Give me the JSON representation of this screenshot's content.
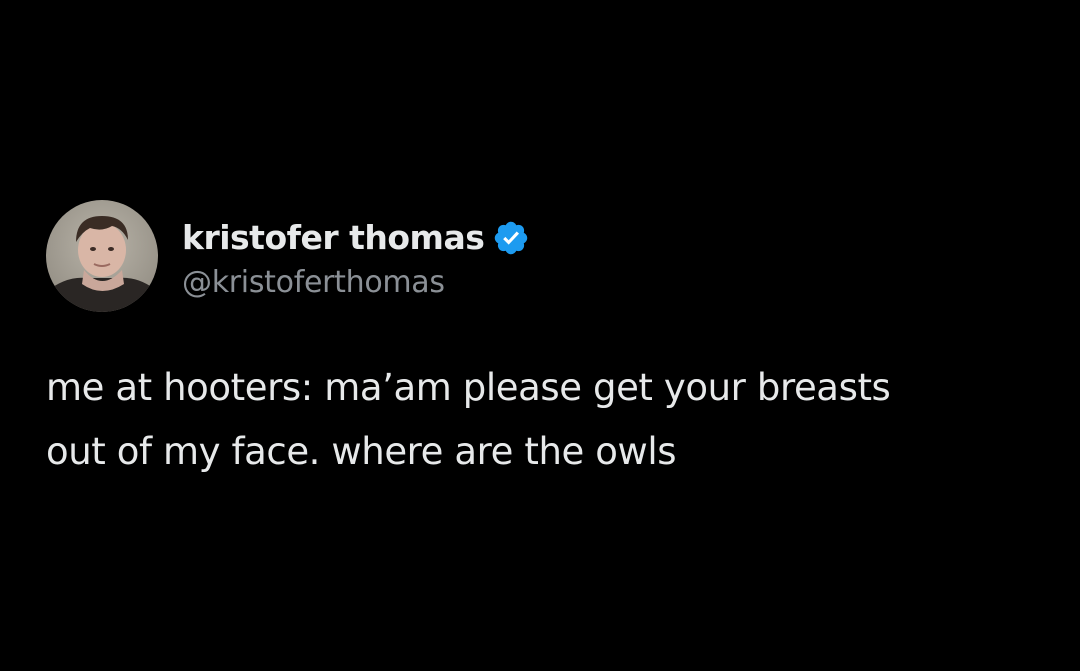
{
  "tweet": {
    "display_name": "kristofer thomas",
    "handle": "@kristoferthomas",
    "verified": true,
    "text_lines": [
      "me at hooters: ma’am please get your breasts",
      "out of my face. where are the owls"
    ]
  },
  "colors": {
    "background": "#000000",
    "name": "#e7e9ea",
    "handle": "#8b9096",
    "verified_badge": "#1d9bf0"
  },
  "icons": {
    "avatar": "profile-photo",
    "badge": "verified-checkmark-icon"
  }
}
